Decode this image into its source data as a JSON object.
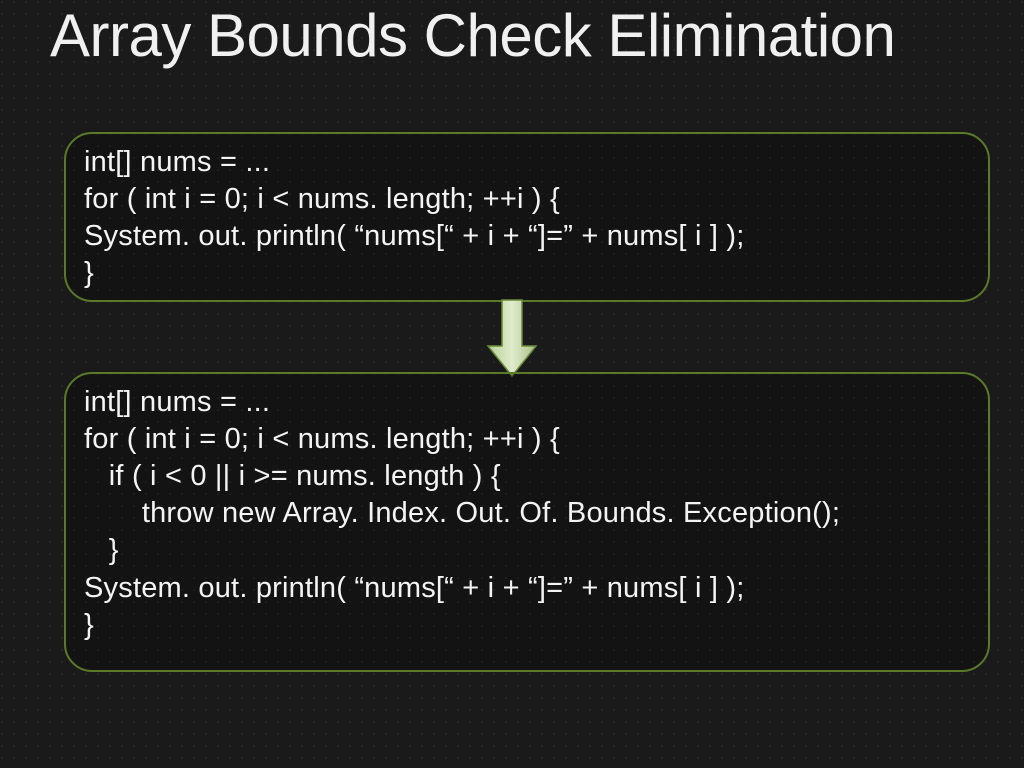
{
  "title": "Array Bounds Check Elimination",
  "code_block_1": "int[] nums = ...\nfor ( int i = 0; i < nums. length; ++i ) {\nSystem. out. println( “nums[“ + i + “]=” + nums[ i ] );\n}",
  "code_block_2": "int[] nums = ...\nfor ( int i = 0; i < nums. length; ++i ) {\n   if ( i < 0 || i >= nums. length ) {\n       throw new Array. Index. Out. Of. Bounds. Exception();\n   }\nSystem. out. println( “nums[“ + i + “]=” + nums[ i ] );\n}",
  "colors": {
    "box_border": "#5a7a2a",
    "background": "#1a1a1a",
    "text": "#e8e8e8",
    "arrow_fill": "#cfe0b8",
    "arrow_stroke": "#6a8a3a"
  }
}
